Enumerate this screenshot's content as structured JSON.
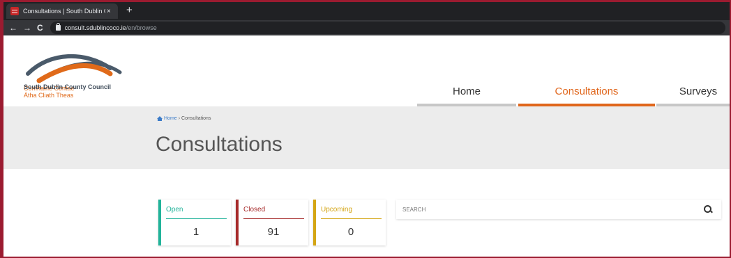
{
  "browser": {
    "tab_title": "Consultations | South Dublin Cou",
    "tab_close": "×",
    "new_tab": "+",
    "back": "←",
    "forward": "→",
    "reload": "C",
    "url_domain": "consult.sdublincoco.ie",
    "url_path": "/en/browse"
  },
  "header": {
    "logo_line1": "Comhairle Contae",
    "logo_line2": "Átha Cliath Theas",
    "logo_line3": "South Dublin County Council",
    "logo_colors": {
      "arc_top": "#4a5a6a",
      "arc_bottom": "#e06a1a"
    },
    "nav": [
      {
        "label": "Home"
      },
      {
        "label": "Consultations",
        "active": true
      },
      {
        "label": "Surveys"
      }
    ]
  },
  "hero": {
    "breadcrumb_home": "Home",
    "breadcrumb_sep": "›",
    "breadcrumb_current": "Consultations",
    "title": "Consultations"
  },
  "cards": {
    "open": {
      "label": "Open",
      "count": "1",
      "color": "#22b39a"
    },
    "closed": {
      "label": "Closed",
      "count": "91",
      "color": "#a62a2a"
    },
    "upcoming": {
      "label": "Upcoming",
      "count": "0",
      "color": "#d4a514"
    }
  },
  "search": {
    "placeholder": "SEARCH"
  },
  "colors": {
    "accent": "#e0661c",
    "frame": "#9b1b30"
  }
}
